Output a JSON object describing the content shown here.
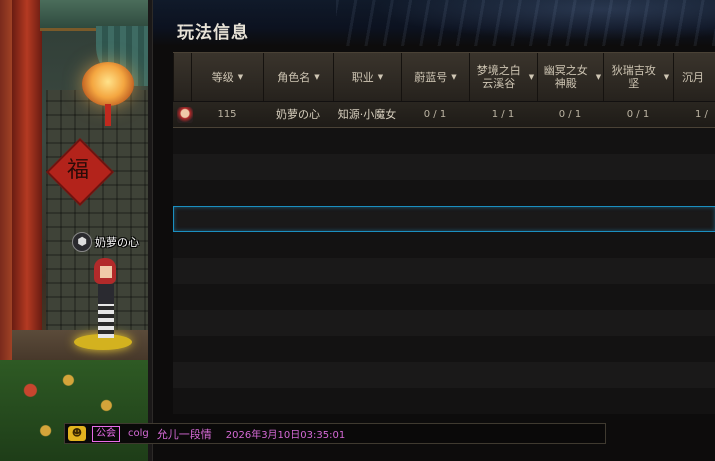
{
  "window": {
    "title": "玩法信息"
  },
  "table": {
    "columns": [
      {
        "label": "等级",
        "sortable": true
      },
      {
        "label": "角色名",
        "sortable": true
      },
      {
        "label": "职业",
        "sortable": true
      },
      {
        "label": "蔚蓝号",
        "sortable": true
      },
      {
        "label": "梦境之白云溪谷",
        "sortable": true
      },
      {
        "label": "幽冥之女神殿",
        "sortable": true
      },
      {
        "label": "狄瑞吉攻坚",
        "sortable": true
      },
      {
        "label": "沉月",
        "sortable": false
      }
    ],
    "rows": [
      {
        "level": "115",
        "name": "奶萝の心",
        "class": "知源·小魔女",
        "c1": "0 / 1",
        "c2": "1 / 1",
        "c3": "0 / 1",
        "c4": "0 / 1",
        "c5": "1 /"
      }
    ]
  },
  "scene": {
    "character_name": "奶萝の心",
    "fu_char": "福"
  },
  "chat": {
    "channel": "公会",
    "sender": "colg",
    "message": "允儿一段情",
    "timestamp": "2026年3月10日03:35:01"
  },
  "icons": {
    "chat_icon": "guild-chat-icon",
    "sort": "caret-down-icon"
  }
}
